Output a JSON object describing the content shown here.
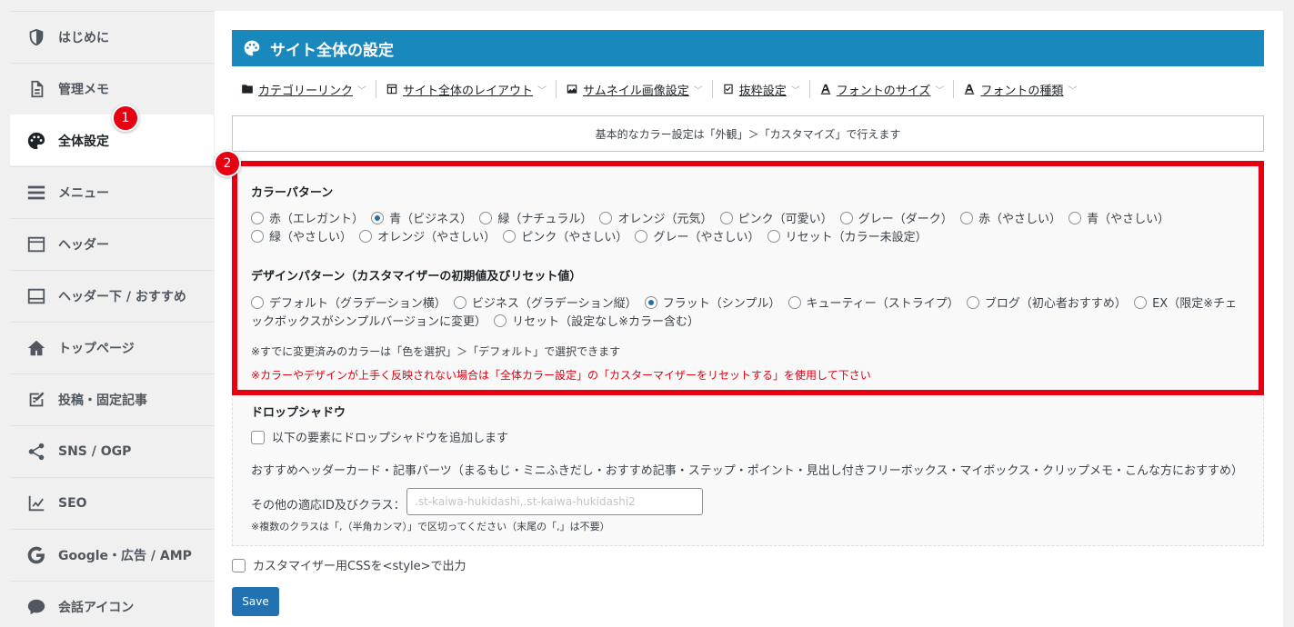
{
  "sidebar": {
    "items": [
      {
        "label": "はじめに",
        "icon": "shield-icon"
      },
      {
        "label": "管理メモ",
        "icon": "document-icon"
      },
      {
        "label": "全体設定",
        "icon": "palette-icon",
        "active": true
      },
      {
        "label": "メニュー",
        "icon": "menu-icon"
      },
      {
        "label": "ヘッダー",
        "icon": "header-icon"
      },
      {
        "label": "ヘッダー下 / おすすめ",
        "icon": "header-below-icon"
      },
      {
        "label": "トップページ",
        "icon": "home-icon"
      },
      {
        "label": "投稿・固定記事",
        "icon": "edit-icon"
      },
      {
        "label": "SNS / OGP",
        "icon": "share-icon"
      },
      {
        "label": "SEO",
        "icon": "chart-icon"
      },
      {
        "label": "Google・広告 / AMP",
        "icon": "google-icon"
      },
      {
        "label": "会話アイコン",
        "icon": "chat-icon"
      }
    ]
  },
  "badges": {
    "first": "1",
    "second": "2"
  },
  "main": {
    "title": "サイト全体の設定",
    "tabs": [
      {
        "label": "カテゴリーリンク",
        "icon": "folder-icon"
      },
      {
        "label": "サイト全体のレイアウト",
        "icon": "layout-icon"
      },
      {
        "label": "サムネイル画像設定",
        "icon": "image-icon"
      },
      {
        "label": "抜粋設定",
        "icon": "excerpt-icon"
      },
      {
        "label": "フォントのサイズ",
        "icon": "font-size-icon"
      },
      {
        "label": "フォントの種類",
        "icon": "font-type-icon"
      }
    ],
    "notice": "基本的なカラー設定は「外観」＞「カスタマイズ」で行えます",
    "color_pattern": {
      "title": "カラーパターン",
      "options": [
        "赤（エレガント）",
        "青（ビジネス）",
        "緑（ナチュラル）",
        "オレンジ（元気）",
        "ピンク（可愛い）",
        "グレー（ダーク）",
        "赤（やさしい）",
        "青（やさしい）",
        "緑（やさしい）",
        "オレンジ（やさしい）",
        "ピンク（やさしい）",
        "グレー（やさしい）",
        "リセット（カラー未設定）"
      ],
      "selected": "青（ビジネス）"
    },
    "design_pattern": {
      "title": "デザインパターン（カスタマイザーの初期値及びリセット値）",
      "options": [
        "デフォルト（グラデーション横）",
        "ビジネス（グラデーション縦）",
        "フラット（シンプル）",
        "キューティー（ストライプ）",
        "ブログ（初心者おすすめ）",
        "EX（限定※チェックボックスがシンプルバージョンに変更）",
        "リセット（設定なし※カラー含む）"
      ],
      "selected": "フラット（シンプル）"
    },
    "note1": "※すでに変更済みのカラーは「色を選択」＞「デフォルト」で選択できます",
    "note2": "※カラーやデザインが上手く反映されない場合は「全体カラー設定」の「カスターマイザーをリセットする」を使用して下さい",
    "drop_shadow": {
      "title": "ドロップシャドウ",
      "checkbox_label": "以下の要素にドロップシャドウを追加します",
      "elements": "おすすめヘッダーカード・記事パーツ（まるもじ・ミニふきだし・おすすめ記事・ステップ・ポイント・見出し付きフリーボックス・マイボックス・クリップメモ・こんな方におすすめ）",
      "other_label": "その他の適応ID及びクラス：",
      "other_placeholder": ".st-kaiwa-hukidashi,.st-kaiwa-hukidashi2",
      "other_note": "※複数のクラスは「,（半角カンマ）」で区切ってください（末尾の「,」は不要）"
    },
    "css_checkbox_label": "カスタマイザー用CSSを<style>で出力",
    "save_label": "Save"
  },
  "colors": {
    "accent": "#1888bd",
    "highlight": "#e60012",
    "button": "#2271b1"
  }
}
